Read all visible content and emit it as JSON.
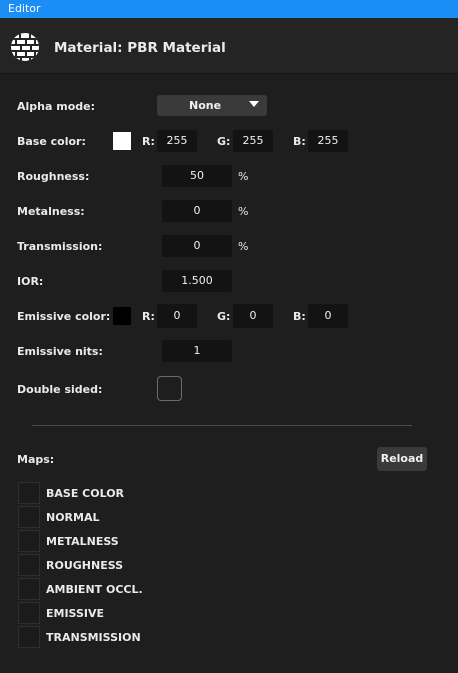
{
  "window": {
    "title": "Editor"
  },
  "header": {
    "title": "Material: PBR Material",
    "icon": "brick-sphere-icon"
  },
  "fields": {
    "alpha_mode": {
      "label": "Alpha mode:",
      "value": "None"
    },
    "base_color": {
      "label": "Base color:",
      "swatch": "#ffffff",
      "r_label": "R:",
      "r": "255",
      "g_label": "G:",
      "g": "255",
      "b_label": "B:",
      "b": "255"
    },
    "roughness": {
      "label": "Roughness:",
      "value": "50",
      "unit": "%"
    },
    "metalness": {
      "label": "Metalness:",
      "value": "0",
      "unit": "%"
    },
    "transmission": {
      "label": "Transmission:",
      "value": "0",
      "unit": "%"
    },
    "ior": {
      "label": "IOR:",
      "value": "1.500"
    },
    "emissive_color": {
      "label": "Emissive color:",
      "swatch": "#000000",
      "r_label": "R:",
      "r": "0",
      "g_label": "G:",
      "g": "0",
      "b_label": "B:",
      "b": "0"
    },
    "emissive_nits": {
      "label": "Emissive nits:",
      "value": "1"
    },
    "double_sided": {
      "label": "Double sided:",
      "checked": false
    }
  },
  "maps": {
    "label": "Maps:",
    "reload_label": "Reload",
    "items": [
      "BASE COLOR",
      "NORMAL",
      "METALNESS",
      "ROUGHNESS",
      "AMBIENT OCCL.",
      "EMISSIVE",
      "TRANSMISSION"
    ]
  },
  "colors": {
    "titlebar": "#1a8ef5",
    "background": "#1e1e1e",
    "field": "#131313"
  }
}
